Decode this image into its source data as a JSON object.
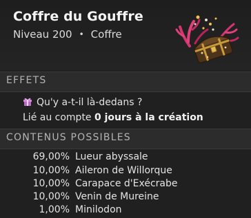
{
  "item": {
    "title": "Coffre du Gouffre",
    "level": "Niveau 200",
    "separator": "•",
    "type": "Coffre"
  },
  "effects": {
    "header": "EFFETS",
    "question": "Qu'y a-t-il là-dedans ?",
    "bound_prefix": "Lié au compte",
    "bound_value": "0 jours à la création"
  },
  "contents": {
    "header": "CONTENUS POSSIBLES",
    "rows": [
      {
        "pct": "69,00%",
        "name": "Lueur abyssale"
      },
      {
        "pct": "10,00%",
        "name": "Aileron de Willorque"
      },
      {
        "pct": "10,00%",
        "name": "Carapace d'Exécrabe"
      },
      {
        "pct": "10,00%",
        "name": "Venin de Mureine"
      },
      {
        "pct": "1,00%",
        "name": "Minilodon"
      }
    ]
  },
  "icons": {
    "item_art": "coral-chest-icon",
    "effect_icon": "gift-icon"
  },
  "colors": {
    "gift_icon": "#d38ad6",
    "chest_wood": "#5a3d1f",
    "chest_gold": "#d8b04a",
    "coral_pink": "#e0417a"
  }
}
